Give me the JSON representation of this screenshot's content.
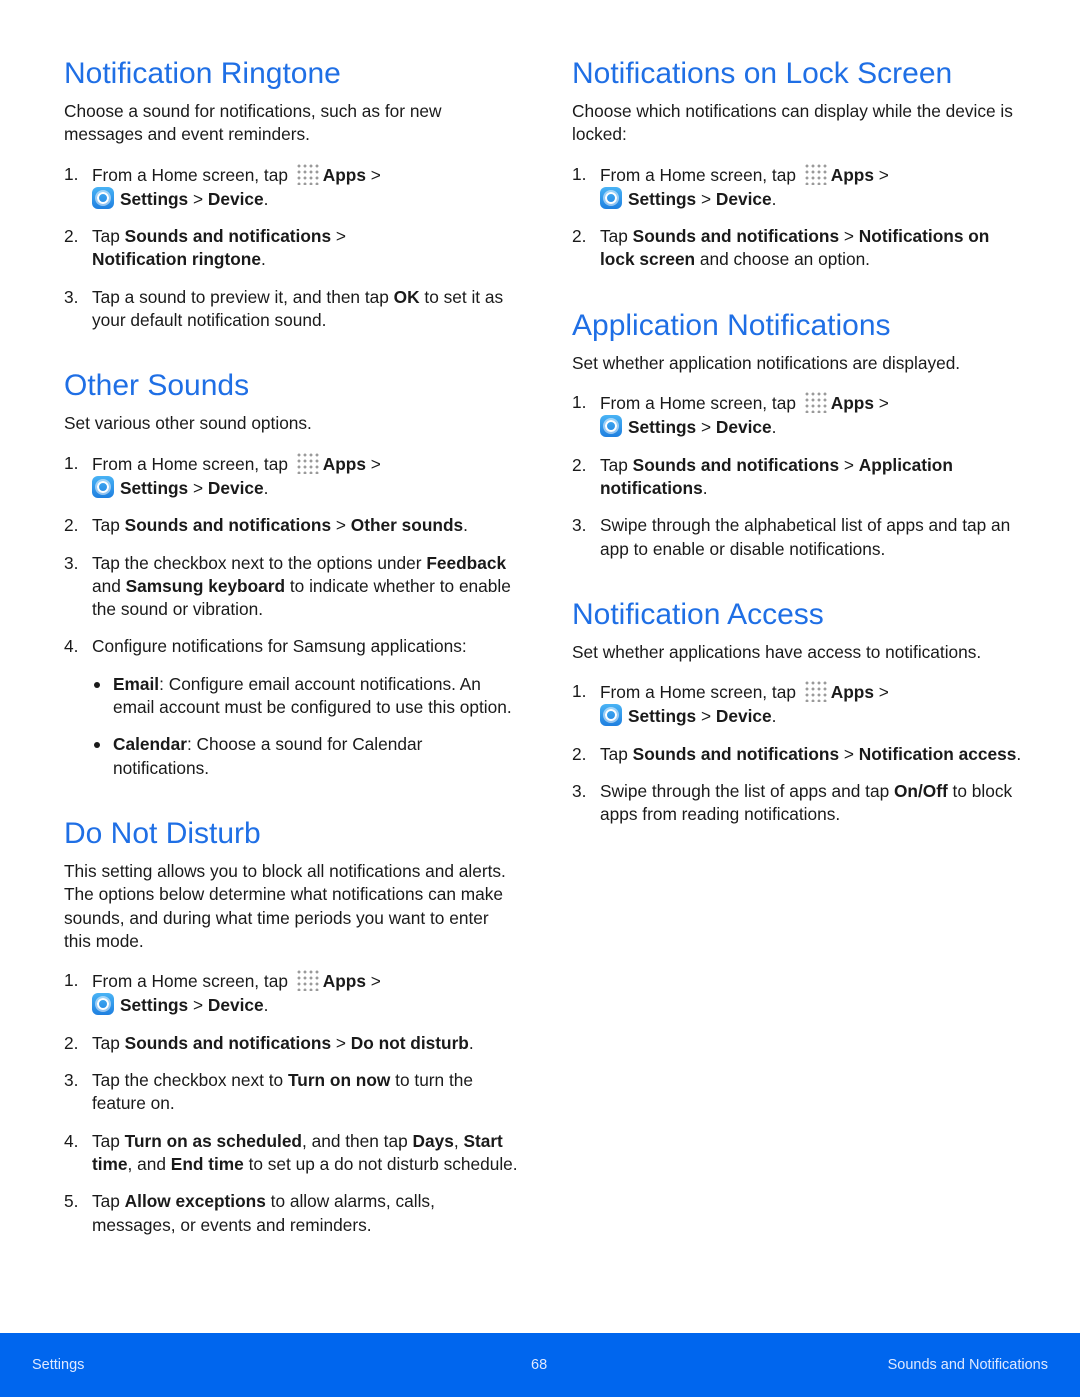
{
  "left": [
    {
      "title": "Notification Ringtone",
      "intro": "Choose a sound for notifications, such as for new messages and event reminders.",
      "steps": [
        [
          {
            "t": "From a Home screen, tap "
          },
          {
            "icon": "apps"
          },
          {
            "b": "Apps"
          },
          {
            "t": " > "
          },
          {
            "br": 1
          },
          {
            "icon": "settings"
          },
          {
            "b": "Settings"
          },
          {
            "t": " > "
          },
          {
            "b": "Device"
          },
          {
            "t": "."
          }
        ],
        [
          {
            "t": "Tap "
          },
          {
            "b": "Sounds and notifications"
          },
          {
            "t": " > "
          },
          {
            "br": 1
          },
          {
            "b": "Notification ringtone"
          },
          {
            "t": "."
          }
        ],
        [
          {
            "t": "Tap a sound to preview it, and then tap "
          },
          {
            "b": "OK"
          },
          {
            "t": " to set it as your default notification sound."
          }
        ]
      ]
    },
    {
      "title": "Other Sounds",
      "intro": "Set various other sound options.",
      "steps": [
        [
          {
            "t": "From a Home screen, tap "
          },
          {
            "icon": "apps"
          },
          {
            "b": "Apps"
          },
          {
            "t": " > "
          },
          {
            "br": 1
          },
          {
            "icon": "settings"
          },
          {
            "b": "Settings"
          },
          {
            "t": " > "
          },
          {
            "b": "Device"
          },
          {
            "t": "."
          }
        ],
        [
          {
            "t": "Tap "
          },
          {
            "b": "Sounds and notifications"
          },
          {
            "t": " > "
          },
          {
            "b": "Other sounds"
          },
          {
            "t": "."
          }
        ],
        [
          {
            "t": "Tap the checkbox next to the options under "
          },
          {
            "b": "Feedback"
          },
          {
            "t": " and "
          },
          {
            "b": "Samsung keyboard"
          },
          {
            "t": " to indicate whether to enable the sound or vibration."
          }
        ],
        [
          {
            "t": "Configure notifications for Samsung applications:"
          }
        ]
      ],
      "bullets": [
        [
          {
            "b": "Email"
          },
          {
            "t": ": Configure email account notifications. An email account must be configured to use this option."
          }
        ],
        [
          {
            "b": "Calendar"
          },
          {
            "t": ": Choose a sound for Calendar notifications."
          }
        ]
      ]
    },
    {
      "title": "Do Not Disturb",
      "intro": "This setting allows you to block all notifications and alerts. The options below determine what notifications can make sounds, and during what time periods you want to enter this mode.",
      "steps": [
        [
          {
            "t": "From a Home screen, tap "
          },
          {
            "icon": "apps"
          },
          {
            "b": "Apps"
          },
          {
            "t": " > "
          },
          {
            "br": 1
          },
          {
            "icon": "settings"
          },
          {
            "b": "Settings"
          },
          {
            "t": " > "
          },
          {
            "b": "Device"
          },
          {
            "t": "."
          }
        ],
        [
          {
            "t": "Tap "
          },
          {
            "b": "Sounds and notifications"
          },
          {
            "t": " > "
          },
          {
            "b": "Do not disturb"
          },
          {
            "t": "."
          }
        ],
        [
          {
            "t": "Tap the checkbox next to "
          },
          {
            "b": "Turn on now"
          },
          {
            "t": " to turn the feature on."
          }
        ],
        [
          {
            "t": "Tap "
          },
          {
            "b": "Turn on as scheduled"
          },
          {
            "t": ", and then tap "
          },
          {
            "b": "Days"
          },
          {
            "t": ", "
          },
          {
            "b": "Start time"
          },
          {
            "t": ", and "
          },
          {
            "b": "End time"
          },
          {
            "t": " to set up a do not disturb schedule."
          }
        ],
        [
          {
            "t": "Tap "
          },
          {
            "b": "Allow exceptions"
          },
          {
            "t": " to allow alarms, calls, messages, or events and reminders."
          }
        ]
      ]
    }
  ],
  "right": [
    {
      "title": "Notifications on Lock Screen",
      "intro": "Choose which notifications can display while the device is locked:",
      "steps": [
        [
          {
            "t": "From a Home screen, tap "
          },
          {
            "icon": "apps"
          },
          {
            "b": "Apps"
          },
          {
            "t": " > "
          },
          {
            "br": 1
          },
          {
            "icon": "settings"
          },
          {
            "b": "Settings"
          },
          {
            "t": " > "
          },
          {
            "b": "Device"
          },
          {
            "t": "."
          }
        ],
        [
          {
            "t": "Tap "
          },
          {
            "b": "Sounds and notifications"
          },
          {
            "t": " > "
          },
          {
            "b": "Notifications on lock screen"
          },
          {
            "t": " and choose an option."
          }
        ]
      ]
    },
    {
      "title": "Application Notifications",
      "intro": "Set whether application notifications are displayed.",
      "steps": [
        [
          {
            "t": "From a Home screen, tap "
          },
          {
            "icon": "apps"
          },
          {
            "b": "Apps"
          },
          {
            "t": " > "
          },
          {
            "br": 1
          },
          {
            "icon": "settings"
          },
          {
            "b": "Settings"
          },
          {
            "t": " > "
          },
          {
            "b": "Device"
          },
          {
            "t": "."
          }
        ],
        [
          {
            "t": "Tap "
          },
          {
            "b": "Sounds and notifications"
          },
          {
            "t": " > "
          },
          {
            "b": "Application notifications"
          },
          {
            "t": "."
          }
        ],
        [
          {
            "t": "Swipe through the alphabetical list of apps and tap an app to enable or disable notifications."
          }
        ]
      ]
    },
    {
      "title": "Notification Access",
      "intro": "Set whether applications have access to notifications.",
      "steps": [
        [
          {
            "t": "From a Home screen, tap "
          },
          {
            "icon": "apps"
          },
          {
            "b": "Apps"
          },
          {
            "t": " > "
          },
          {
            "br": 1
          },
          {
            "icon": "settings"
          },
          {
            "b": "Settings"
          },
          {
            "t": " > "
          },
          {
            "b": "Device"
          },
          {
            "t": "."
          }
        ],
        [
          {
            "t": "Tap "
          },
          {
            "b": "Sounds and notifications"
          },
          {
            "t": " > "
          },
          {
            "b": "Notification access"
          },
          {
            "t": "."
          }
        ],
        [
          {
            "t": "Swipe through the list of apps and tap "
          },
          {
            "b": "On/Off"
          },
          {
            "t": " to block apps from reading notifications."
          }
        ]
      ]
    }
  ],
  "footer": {
    "left": "Settings",
    "page": "68",
    "right": "Sounds and Notifications",
    "color": "#0066ee"
  }
}
